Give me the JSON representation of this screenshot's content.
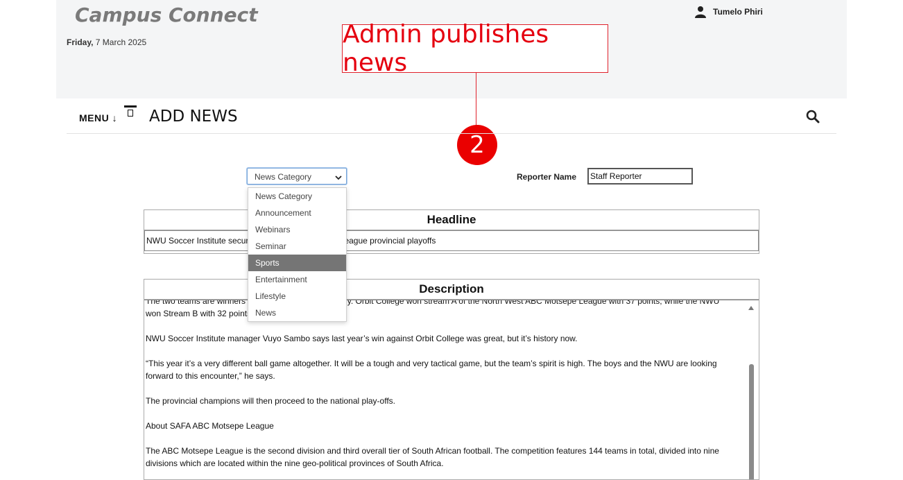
{
  "header": {
    "brand": "Campus Connect",
    "date_day": "Friday,",
    "date_rest": " 7 March 2025",
    "user_name": "Tumelo Phiri"
  },
  "annotation": {
    "callout_text": "Admin publishes news",
    "step_number": "2",
    "color": "#e5000f"
  },
  "toolbar": {
    "menu_label": "MENU ↓",
    "page_title": "ADD NEWS"
  },
  "form": {
    "category_select": {
      "selected": "News Category",
      "options": [
        "News Category",
        "Announcement",
        "Webinars",
        "Seminar",
        "Sports",
        "Entertainment",
        "Lifestyle",
        "News"
      ],
      "highlighted": "Sports"
    },
    "reporter_label": "Reporter Name",
    "reporter_value": "Staff Reporter",
    "headline_title": "Headline",
    "headline_value": "NWU Soccer Institute secures spot in ABC Motsepe League provincial playoffs",
    "description_title": "Description",
    "description_paragraphs": [
      "The two teams are winners of their streams respectively. Orbit College won stream A of the North West ABC Motsepe League with 37 points, while the NWU won Stream B with 32 points.",
      "NWU Soccer Institute manager Vuyo Sambo says last year’s win against Orbit College was great, but it’s history now.",
      "“This year it’s a very different ball game altogether. It will be a tough and very tactical game, but the team’s spirit is high. The boys and the NWU are looking forward to this encounter,” he says.",
      "The provincial champions will then proceed to the national play-offs.",
      "About SAFA ABC Motsepe League",
      "The ABC Motsepe League is the second division and third overall tier of South African football. The competition features 144 teams in total, divided into nine divisions which are located within the nine geo-political provinces of South Africa."
    ]
  }
}
